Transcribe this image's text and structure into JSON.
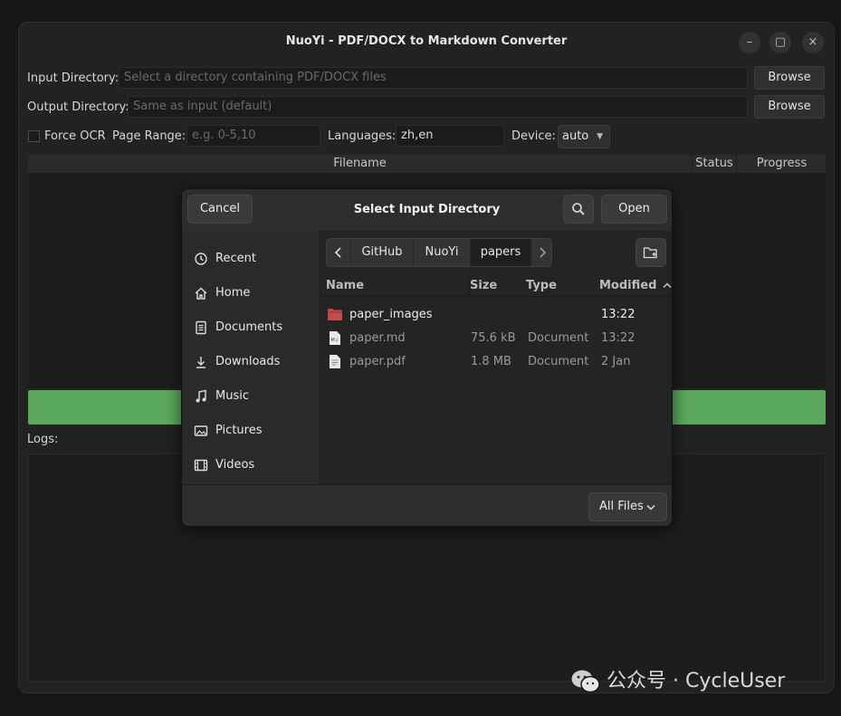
{
  "window": {
    "title": "NuoYi - PDF/DOCX to Markdown Converter",
    "minimize_label": "–",
    "maximize_label": "▢",
    "close_label": "×"
  },
  "form": {
    "input_dir_label": "Input Directory:",
    "input_dir_placeholder": "Select a directory containing PDF/DOCX files",
    "output_dir_label": "Output Directory:",
    "output_dir_placeholder": "Same as input (default)",
    "browse_label": "Browse",
    "force_ocr_label": "Force OCR",
    "page_range_label": "Page Range:",
    "page_range_placeholder": "e.g. 0-5,10",
    "languages_label": "Languages:",
    "languages_value": "zh,en",
    "device_label": "Device:",
    "device_value": "auto"
  },
  "table": {
    "columns": [
      "Filename",
      "Status",
      "Progress"
    ]
  },
  "logs_label": "Logs:",
  "dialog": {
    "title": "Select Input Directory",
    "cancel_label": "Cancel",
    "open_label": "Open",
    "sidebar": [
      {
        "label": "Recent",
        "icon": "clock-icon"
      },
      {
        "label": "Home",
        "icon": "home-icon"
      },
      {
        "label": "Documents",
        "icon": "document-icon"
      },
      {
        "label": "Downloads",
        "icon": "download-icon"
      },
      {
        "label": "Music",
        "icon": "music-icon"
      },
      {
        "label": "Pictures",
        "icon": "picture-icon"
      },
      {
        "label": "Videos",
        "icon": "video-icon"
      }
    ],
    "breadcrumb": [
      "GitHub",
      "NuoYi",
      "papers"
    ],
    "columns": {
      "name": "Name",
      "size": "Size",
      "type": "Type",
      "modified": "Modified"
    },
    "files": [
      {
        "name": "paper_images",
        "size": "",
        "type": "",
        "modified": "13:22",
        "kind": "folder"
      },
      {
        "name": "paper.md",
        "size": "75.6 kB",
        "type": "Document",
        "modified": "13:22",
        "kind": "md"
      },
      {
        "name": "paper.pdf",
        "size": "1.8 MB",
        "type": "Document",
        "modified": "2 Jan",
        "kind": "pdf"
      }
    ],
    "filter_value": "All Files"
  },
  "watermark": "公众号 · CycleUser",
  "colors": {
    "accent_green": "#5aa85d",
    "folder": "#c24b4b"
  }
}
